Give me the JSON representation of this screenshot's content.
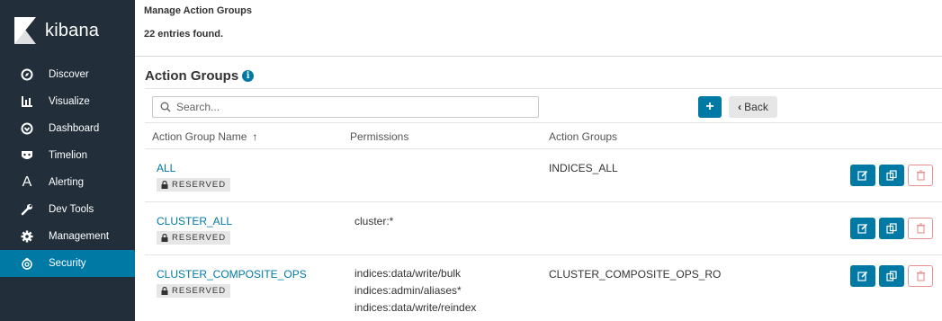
{
  "app": {
    "logo_text": "kibana"
  },
  "sidebar": {
    "items": [
      {
        "label": "Discover",
        "icon": "compass-icon"
      },
      {
        "label": "Visualize",
        "icon": "bar-chart-icon"
      },
      {
        "label": "Dashboard",
        "icon": "dashboard-icon"
      },
      {
        "label": "Timelion",
        "icon": "timelion-icon"
      },
      {
        "label": "Alerting",
        "icon": "alerting-icon"
      },
      {
        "label": "Dev Tools",
        "icon": "wrench-icon"
      },
      {
        "label": "Management",
        "icon": "gear-icon"
      },
      {
        "label": "Security",
        "icon": "security-icon",
        "active": true
      }
    ]
  },
  "header": {
    "title": "Manage Action Groups",
    "subtitle": "22 entries found."
  },
  "section": {
    "title": "Action Groups"
  },
  "toolbar": {
    "search_placeholder": "Search...",
    "add_label": "+",
    "back_label": "Back"
  },
  "table": {
    "columns": [
      "Action Group Name",
      "Permissions",
      "Action Groups"
    ],
    "reserved_label": "RESERVED",
    "rows": [
      {
        "name": "ALL",
        "permissions": [],
        "action_groups": [
          "INDICES_ALL"
        ]
      },
      {
        "name": "CLUSTER_ALL",
        "permissions": [
          "cluster:*"
        ],
        "action_groups": []
      },
      {
        "name": "CLUSTER_COMPOSITE_OPS",
        "permissions": [
          "indices:data/write/bulk",
          "indices:admin/aliases*",
          "indices:data/write/reindex"
        ],
        "action_groups": [
          "CLUSTER_COMPOSITE_OPS_RO"
        ]
      }
    ]
  },
  "colors": {
    "sidebar_bg": "#222f3b",
    "accent": "#0079a5",
    "delete_border": "#e79090"
  }
}
